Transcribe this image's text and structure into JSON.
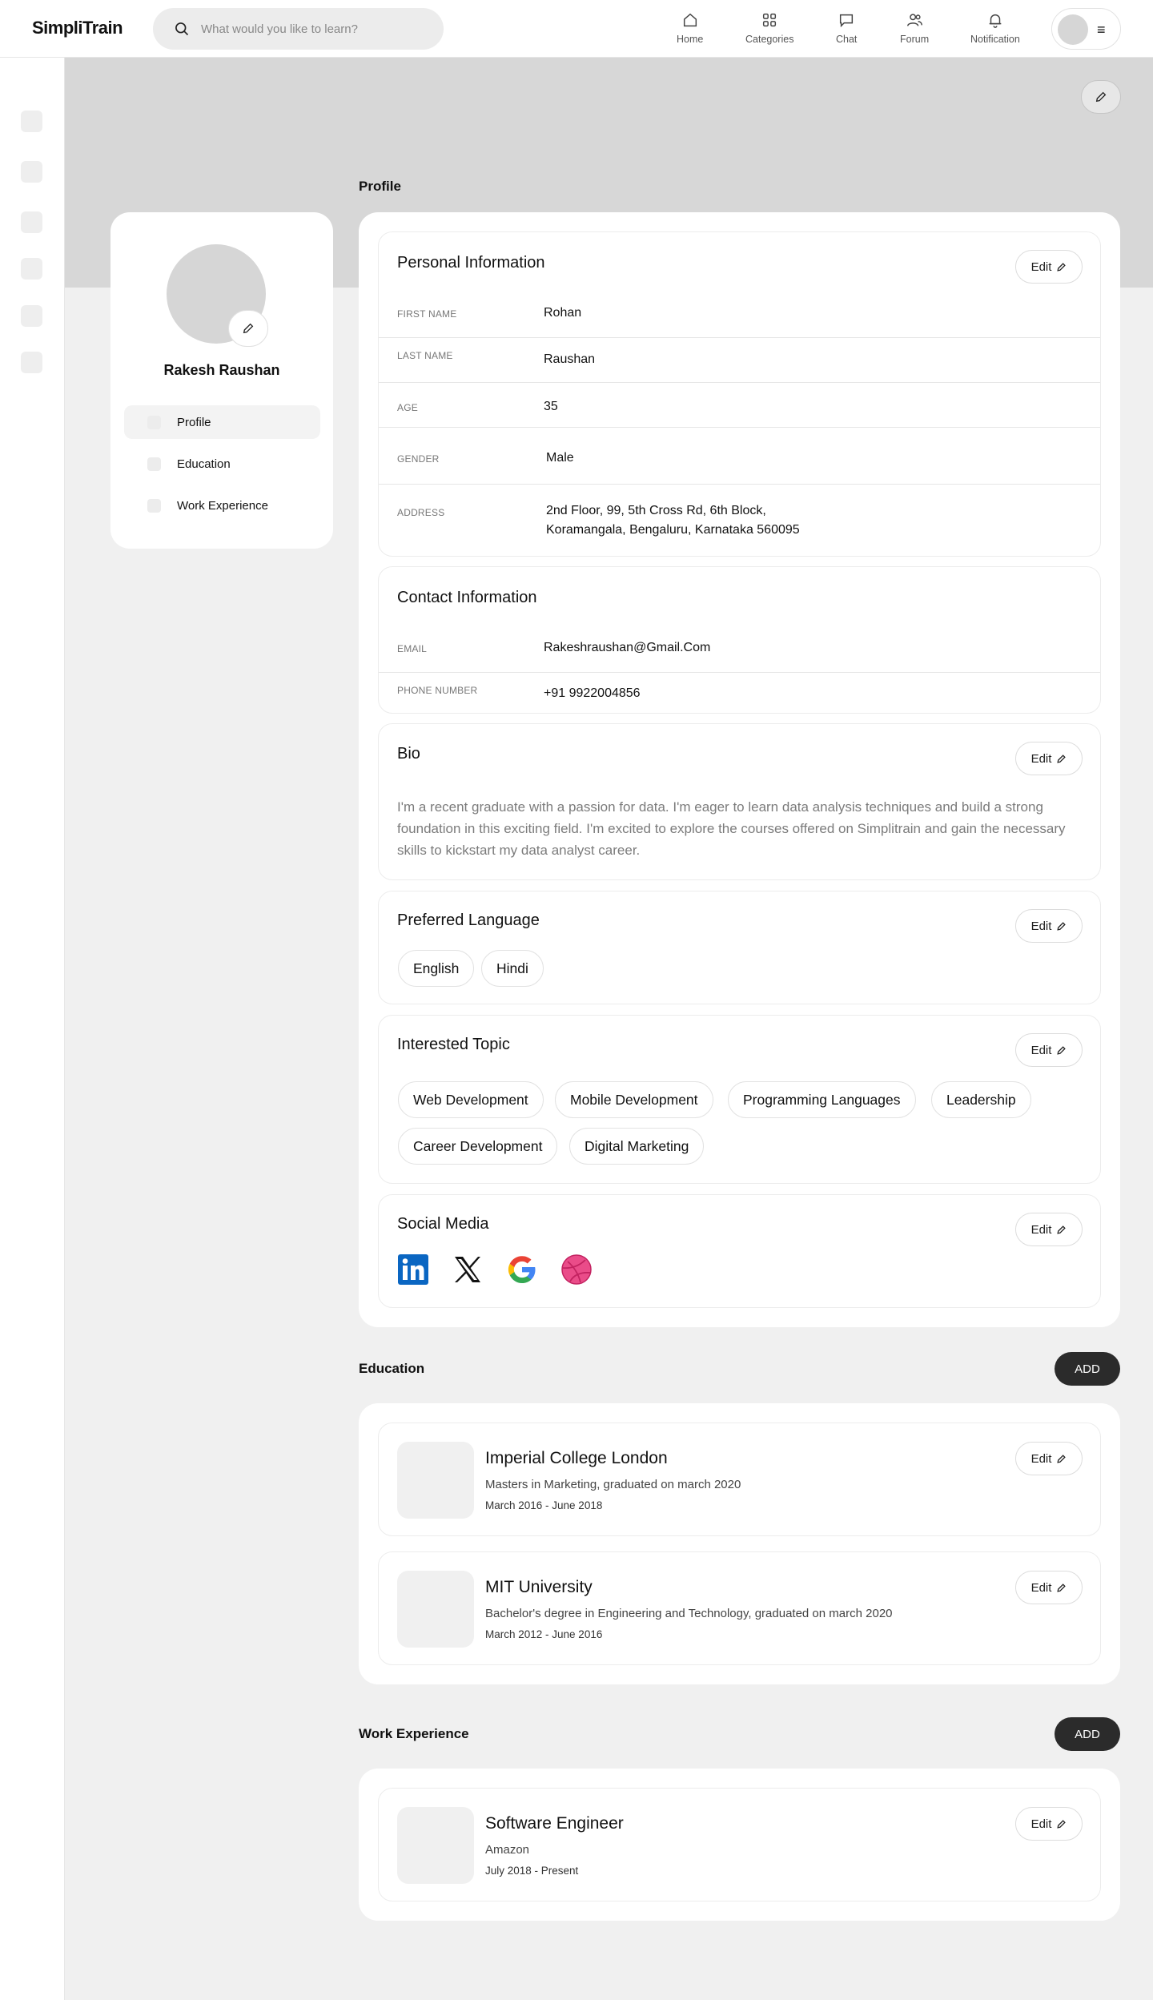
{
  "header": {
    "logo": "SimpliTrain",
    "search_placeholder": "What would you like to learn?",
    "nav": [
      {
        "label": "Home",
        "icon": "home-icon"
      },
      {
        "label": "Categories",
        "icon": "grid-icon"
      },
      {
        "label": "Chat",
        "icon": "chat-icon"
      },
      {
        "label": "Forum",
        "icon": "users-icon"
      },
      {
        "label": "Notification",
        "icon": "bell-icon"
      }
    ],
    "menu_icon": "≡"
  },
  "sidebar": {
    "user_name": "Rakesh Raushan",
    "items": [
      {
        "label": "Profile",
        "active": true
      },
      {
        "label": "Education",
        "active": false
      },
      {
        "label": "Work Experience",
        "active": false
      }
    ]
  },
  "profile": {
    "section_title": "Profile",
    "edit_label": "Edit",
    "personal": {
      "title": "Personal Information",
      "fields": [
        {
          "key": "FIRST NAME",
          "value": "Rohan"
        },
        {
          "key": "LAST NAME",
          "value": "Raushan"
        },
        {
          "key": "AGE",
          "value": "35"
        },
        {
          "key": "GENDER",
          "value": "Male"
        },
        {
          "key": "ADDRESS",
          "value_line1": "2nd Floor, 99, 5th Cross Rd, 6th Block,",
          "value_line2": "Koramangala, Bengaluru, Karnataka 560095"
        }
      ]
    },
    "contact": {
      "title": "Contact Information",
      "fields": [
        {
          "key": "EMAIL",
          "value": "Rakeshraushan@Gmail.Com"
        },
        {
          "key": "PHONE NUMBER",
          "value": "+91 9922004856"
        }
      ]
    },
    "bio": {
      "title": "Bio",
      "text": "I'm a recent graduate with a passion for data. I'm eager to learn data analysis techniques and build a strong foundation in this exciting field. I'm excited to explore the courses offered on Simplitrain and gain the necessary skills to kickstart my data analyst career."
    },
    "language": {
      "title": "Preferred Language",
      "items": [
        "English",
        "Hindi"
      ]
    },
    "topics": {
      "title": "Interested Topic",
      "items": [
        "Web Development",
        "Mobile Development",
        "Programming Languages",
        "Leadership",
        "Career Development",
        "Digital Marketing"
      ]
    },
    "social": {
      "title": "Social Media",
      "items": [
        "linkedin-icon",
        "x-icon",
        "google-icon",
        "dribbble-icon"
      ],
      "colors": {
        "linkedin": "#0A66C2",
        "dribbble": "#EA4C89"
      }
    }
  },
  "education": {
    "section_title": "Education",
    "add_label": "ADD",
    "items": [
      {
        "title": "Imperial College London",
        "subtitle": "Masters in Marketing, graduated on march 2020",
        "dates": "March 2016 - June 2018"
      },
      {
        "title": "MIT University",
        "subtitle": "Bachelor's degree in Engineering and Technology, graduated on march 2020",
        "dates": "March 2012 - June 2016"
      }
    ]
  },
  "work": {
    "section_title": "Work Experience",
    "add_label": "ADD",
    "items": [
      {
        "title": "Software Engineer",
        "subtitle": "Amazon",
        "dates": "July 2018 - Present"
      }
    ]
  }
}
